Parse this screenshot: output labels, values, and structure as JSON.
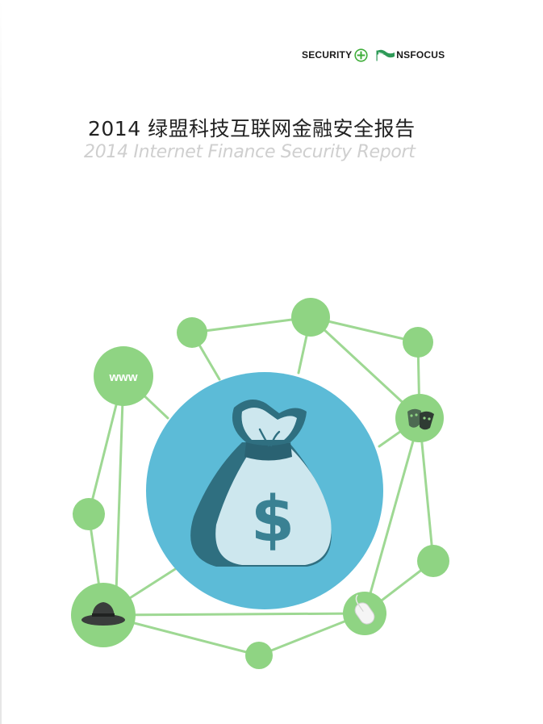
{
  "header": {
    "logo_security_text": "SECURITY",
    "logo_nsfocus_text": "NSFOCUS"
  },
  "title": {
    "chinese": "2014 绿盟科技互联网金融安全报告",
    "english": "2014 Internet Finance Security Report"
  },
  "illustration": {
    "www_label": "www",
    "dollar_symbol": "$",
    "icons": [
      "money-bag-icon",
      "theater-masks-icon",
      "black-hat-icon",
      "computer-mouse-icon",
      "www-icon"
    ]
  },
  "colors": {
    "node_green": "#8fd483",
    "line_green": "#9ed893",
    "center_blue": "#5cbbd7",
    "bag_dark": "#2f6f80",
    "bag_light": "#cde7ee",
    "dollar": "#3a8193",
    "title_gray": "#cfcfcf"
  }
}
